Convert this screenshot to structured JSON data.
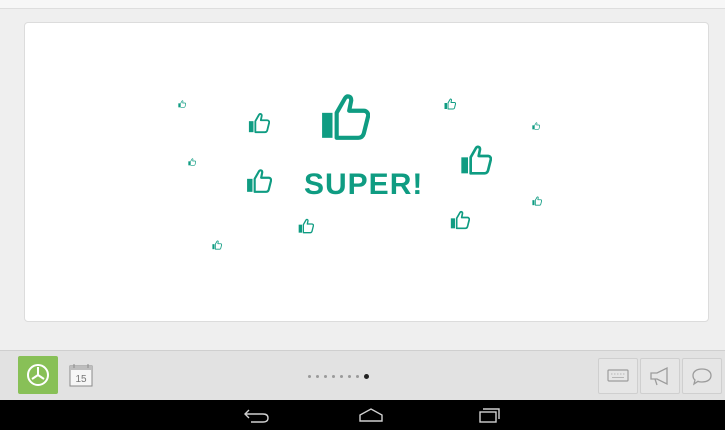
{
  "message": {
    "text": "SUPER!"
  },
  "colors": {
    "accent": "#0f9c82",
    "clock_bg": "#88c057",
    "nav_bar": "#000000"
  },
  "toolbar": {
    "left": [
      {
        "name": "clock-icon",
        "active": true
      },
      {
        "name": "calendar-icon",
        "day": "15"
      }
    ],
    "pager": {
      "count": 8,
      "active_index": 7
    },
    "right": [
      {
        "name": "keyboard-icon"
      },
      {
        "name": "megaphone-icon"
      },
      {
        "name": "speech-bubble-icon"
      }
    ]
  },
  "system_nav": [
    {
      "name": "back-icon"
    },
    {
      "name": "home-icon"
    },
    {
      "name": "recent-apps-icon"
    }
  ]
}
